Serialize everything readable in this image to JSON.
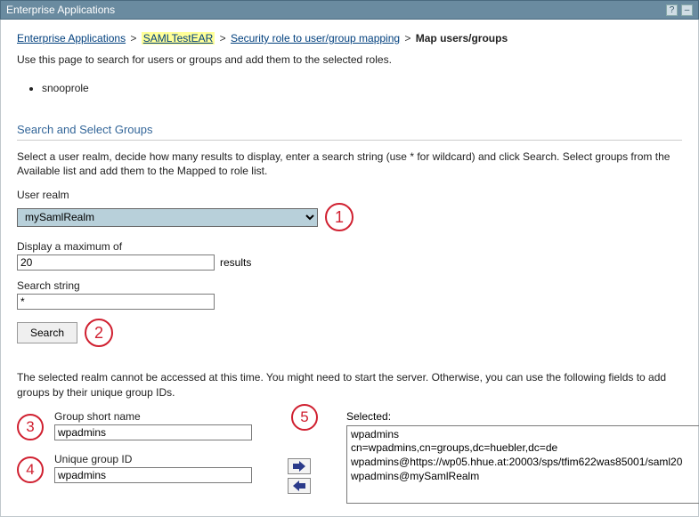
{
  "titleBar": {
    "title": "Enterprise Applications",
    "helpIcon": "?",
    "minimizeIcon": "–"
  },
  "breadcrumb": {
    "link1": "Enterprise Applications",
    "link2": "SAMLTestEAR",
    "link3": "Security role to user/group mapping",
    "current": "Map users/groups",
    "sep": ">"
  },
  "pageDescription": "Use this page to search for users or groups and add them to the selected roles.",
  "roles": [
    "snooprole"
  ],
  "section": {
    "header": "Search and Select Groups",
    "note": "Select a user realm, decide how many results to display, enter a search string (use * for wildcard) and click Search. Select groups from the Available list and add them to the Mapped to role list."
  },
  "form": {
    "userRealmLabel": "User realm",
    "userRealmValue": "mySamlRealm",
    "displayMaxLabel": "Display a maximum of",
    "displayMaxValue": "20",
    "resultsSuffix": "results",
    "searchStringLabel": "Search string",
    "searchStringValue": "*",
    "searchButton": "Search"
  },
  "errorMsg": "The selected realm cannot be accessed at this time. You might need to start the server. Otherwise, you can use the following fields to add groups by their unique group IDs.",
  "groupFields": {
    "shortNameLabel": "Group short name",
    "shortNameValue": "wpadmins",
    "uniqueIdLabel": "Unique group ID",
    "uniqueIdValue": "wpadmins"
  },
  "selected": {
    "label": "Selected:",
    "lines": [
      "wpadmins",
      "cn=wpadmins,cn=groups,dc=huebler,dc=de",
      "wpadmins@https://wp05.hhue.at:20003/sps/tfim622was85001/saml20",
      "wpadmins@mySamlRealm"
    ]
  },
  "markers": {
    "m1": "1",
    "m2": "2",
    "m3": "3",
    "m4": "4",
    "m5": "5"
  }
}
